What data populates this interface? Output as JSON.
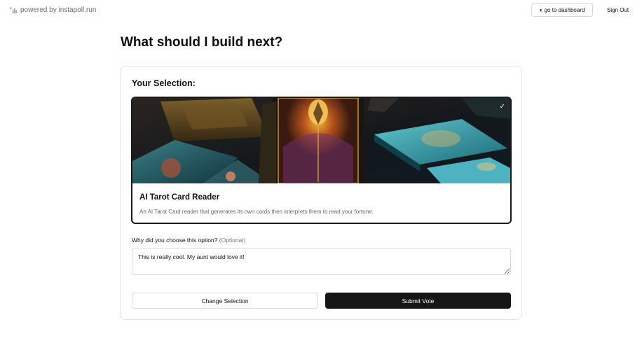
{
  "header": {
    "brand_text": "powered by instapoll.run",
    "brand_icon": "sparkle-bars-icon",
    "dashboard_label": "go to dashboard",
    "dashboard_icon": "chevrons-left-icon",
    "signout_label": "Sign Out"
  },
  "page": {
    "title": "What should I build next?"
  },
  "selection": {
    "label": "Your Selection:",
    "option": {
      "title": "AI Tarot Card Reader",
      "description": "An AI Tarot Card reader that generates its own cards then interprets them to read your fortune.",
      "selected": true,
      "check_icon": "check-icon"
    }
  },
  "reason": {
    "label": "Why did you choose this option?",
    "optional_label": "(Optional)",
    "value": "This is really cool. My aunt would love it!"
  },
  "actions": {
    "change_label": "Change Selection",
    "submit_label": "Submit Vote"
  },
  "colors": {
    "accent_dark": "#161616",
    "border": "#d9d9d9",
    "muted_text": "#666666"
  }
}
